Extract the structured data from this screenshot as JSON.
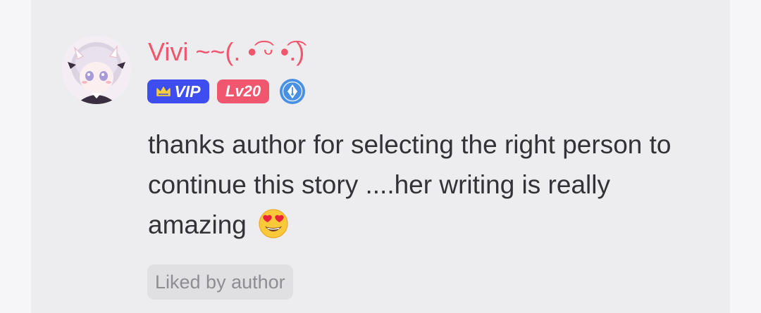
{
  "comment": {
    "username": "Vivi ~~(. •͡ ᵕ •͡.)",
    "badges": {
      "vip_label": "VIP",
      "level_label": "Lv20",
      "vip_icon": "crown-icon",
      "author_icon": "pen-nib-badge-icon"
    },
    "text": "thanks author for selecting the right person to continue this story ....her writing is really amazing",
    "emoji": "heart-eyes-emoji",
    "liked_label": "Liked by author"
  },
  "colors": {
    "username": "#f0566e",
    "vip_badge": "#3d4df0",
    "level_badge": "#f0566e",
    "card_background": "#ededef",
    "page_background": "#f6f6f8",
    "text": "#333337",
    "liked_pill": "#e0e0e3",
    "liked_text": "#8d8d92"
  }
}
